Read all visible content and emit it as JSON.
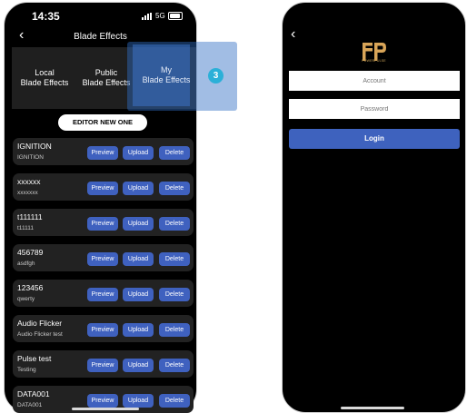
{
  "left_screen": {
    "status_bar": {
      "time": "14:35",
      "network": "5G"
    },
    "title": "Blade Effects",
    "tabs": [
      {
        "line1": "Local",
        "line2": "Blade Effects"
      },
      {
        "line1": "Public",
        "line2": "Blade Effects"
      },
      {
        "line1": "My",
        "line2": "Blade Effects"
      }
    ],
    "step_badge": "3",
    "editor_button": "EDITOR NEW ONE",
    "actions": {
      "preview": "Preview",
      "upload": "Upload",
      "delete": "Delete"
    },
    "effects": [
      {
        "name": "IGNITION",
        "desc": "IGNITION"
      },
      {
        "name": "xxxxxx",
        "desc": "xxxxxxx"
      },
      {
        "name": "t111111",
        "desc": "t11111"
      },
      {
        "name": "456789",
        "desc": "asdfgh"
      },
      {
        "name": "123456",
        "desc": "qwerty"
      },
      {
        "name": "Audio Flicker",
        "desc": "Audio Flicker test"
      },
      {
        "name": "Pulse test",
        "desc": "Testing"
      },
      {
        "name": "DATA001",
        "desc": "DATA001"
      }
    ],
    "colors": {
      "accent": "#3f61bf",
      "highlight": "#2bb0d8"
    }
  },
  "right_screen": {
    "logo_caption": "POWERPULSE",
    "account_placeholder": "Account",
    "password_placeholder": "Password",
    "login_label": "Login"
  }
}
